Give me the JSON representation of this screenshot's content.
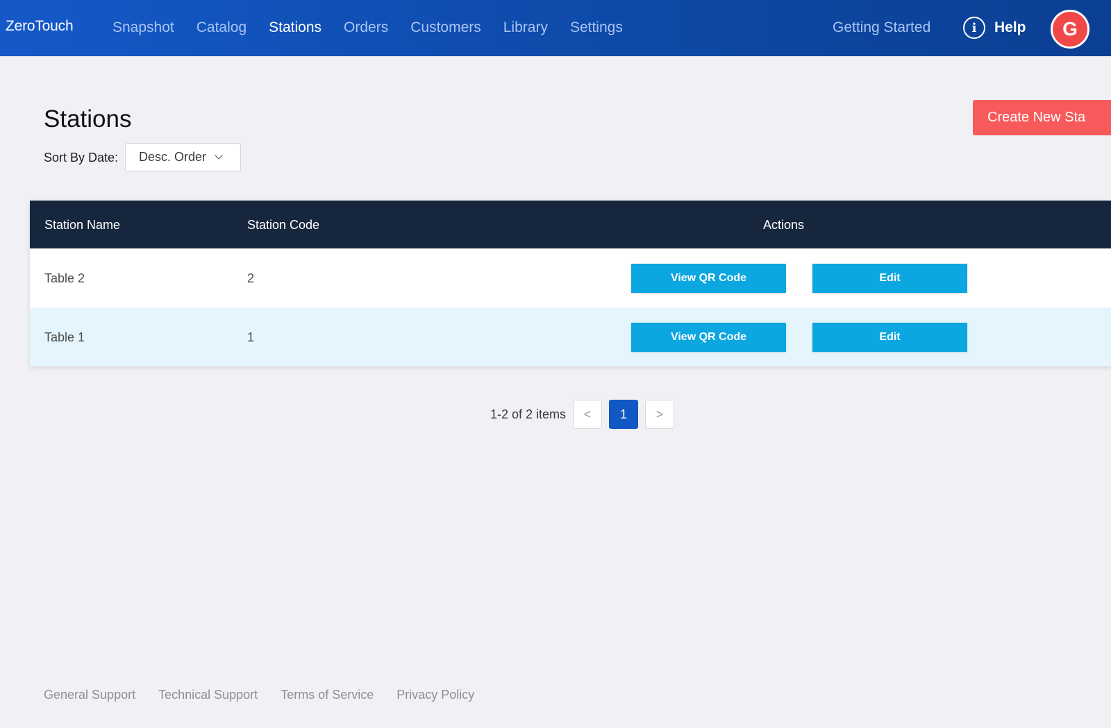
{
  "app": {
    "brand": "ZeroTouch"
  },
  "nav": {
    "items": [
      {
        "label": "Snapshot",
        "active": false
      },
      {
        "label": "Catalog",
        "active": false
      },
      {
        "label": "Stations",
        "active": true
      },
      {
        "label": "Orders",
        "active": false
      },
      {
        "label": "Customers",
        "active": false
      },
      {
        "label": "Library",
        "active": false
      },
      {
        "label": "Settings",
        "active": false
      }
    ],
    "getting_started": "Getting Started",
    "help_label": "Help",
    "help_icon_glyph": "i",
    "avatar_initial": "G"
  },
  "page": {
    "title": "Stations",
    "sort_label": "Sort By Date:",
    "sort_value": "Desc. Order",
    "create_button": "Create New Sta"
  },
  "table": {
    "columns": [
      "Station Name",
      "Station Code",
      "Actions"
    ],
    "rows": [
      {
        "name": "Table 2",
        "code": "2",
        "qr_label": "View QR Code",
        "edit_label": "Edit"
      },
      {
        "name": "Table 1",
        "code": "1",
        "qr_label": "View QR Code",
        "edit_label": "Edit"
      }
    ]
  },
  "pagination": {
    "summary": "1-2 of 2 items",
    "prev": "<",
    "current": "1",
    "next": ">"
  },
  "footer": {
    "links": [
      "General Support",
      "Technical Support",
      "Terms of Service",
      "Privacy Policy"
    ]
  },
  "colors": {
    "nav_bg": "#1559c8",
    "create_button": "#f75a5a",
    "action_button": "#0ca6e1",
    "table_header": "#16263d",
    "row_alt": "#e4f5fd",
    "pagination_active": "#1158c4"
  }
}
